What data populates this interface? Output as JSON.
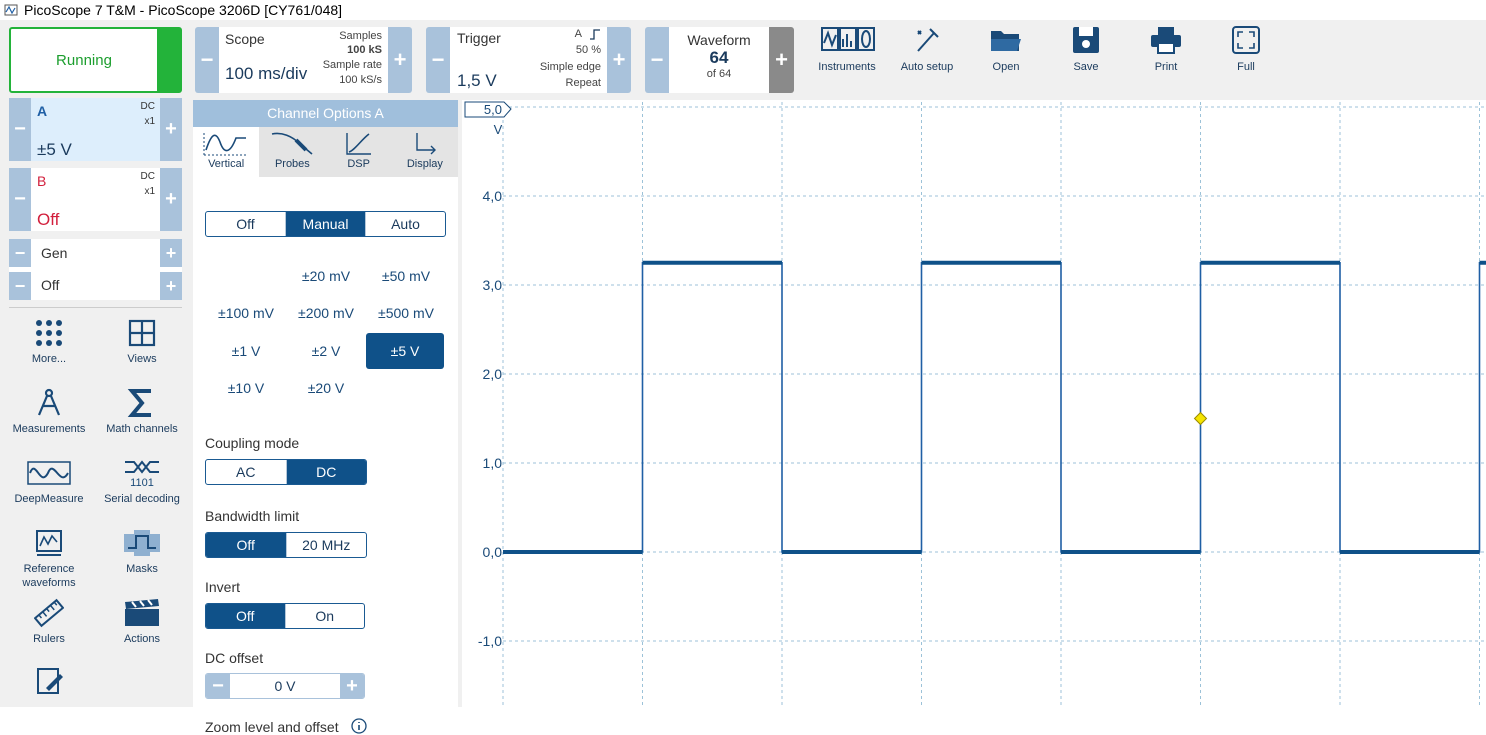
{
  "window": {
    "title": "PicoScope 7 T&M  - PicoScope 3206D [CY761/048]"
  },
  "toolbar": {
    "run": "Running",
    "scope": {
      "label": "Scope",
      "timebase": "100 ms/div",
      "samples_label": "Samples",
      "samples": "100 kS",
      "rate_label": "Sample rate",
      "rate": "100 kS/s"
    },
    "trigger": {
      "label": "Trigger",
      "level": "1,5 V",
      "channel": "A",
      "percent": "50 %",
      "type": "Simple edge",
      "mode": "Repeat"
    },
    "waveform": {
      "label": "Waveform",
      "current": "64",
      "of": "of 64"
    },
    "buttons": [
      "Instruments",
      "Auto setup",
      "Open",
      "Save",
      "Print",
      "Full"
    ]
  },
  "channels": {
    "a": {
      "name": "A",
      "coupling": "DC",
      "probe": "x1",
      "range": "±5 V",
      "color": "#1f5fa5"
    },
    "b": {
      "name": "B",
      "coupling": "DC",
      "probe": "x1",
      "range": "Off",
      "color": "#d21f3c"
    },
    "gen": {
      "label": "Gen",
      "state": "Off"
    }
  },
  "tools": [
    {
      "label": "More...",
      "icon": "dots-grid-icon"
    },
    {
      "label": "Views",
      "icon": "views-grid-icon"
    },
    {
      "label": "Measurements",
      "icon": "compass-icon"
    },
    {
      "label": "Math channels",
      "icon": "sigma-icon"
    },
    {
      "label": "DeepMeasure",
      "icon": "deepmeasure-icon"
    },
    {
      "label": "Serial decoding",
      "icon": "serial-decoding-icon"
    },
    {
      "label": "Reference waveforms",
      "icon": "reference-waveform-icon"
    },
    {
      "label": "Masks",
      "icon": "mask-icon"
    },
    {
      "label": "Rulers",
      "icon": "ruler-icon"
    },
    {
      "label": "Actions",
      "icon": "clapperboard-icon"
    }
  ],
  "options": {
    "title": "Channel Options",
    "channel": "A",
    "tabs": [
      "Vertical",
      "Probes",
      "DSP",
      "Display"
    ],
    "range_mode": [
      "Off",
      "Manual",
      "Auto"
    ],
    "range_mode_selected": "Manual",
    "ranges": [
      "±20 mV",
      "±50 mV",
      "±100 mV",
      "±200 mV",
      "±500 mV",
      "±1 V",
      "±2 V",
      "±5 V",
      "±10 V",
      "±20 V"
    ],
    "range_selected": "±5 V",
    "coupling_label": "Coupling mode",
    "coupling": [
      "AC",
      "DC"
    ],
    "coupling_selected": "DC",
    "bandwidth_label": "Bandwidth limit",
    "bandwidth": [
      "Off",
      "20 MHz"
    ],
    "bandwidth_selected": "Off",
    "invert_label": "Invert",
    "invert": [
      "Off",
      "On"
    ],
    "invert_selected": "Off",
    "offset_label": "DC offset",
    "offset_value": "0 V",
    "zoom_label": "Zoom level and offset"
  },
  "chart_data": {
    "type": "line",
    "unit": "V",
    "y_ticks": [
      "5,0",
      "4,0",
      "3,0",
      "2,0",
      "1,0",
      "0,0",
      "-1,0"
    ],
    "grid": true,
    "trigger_level": 1.5,
    "series": [
      {
        "x": [
          0,
          1.55,
          1.55,
          3.1,
          3.1,
          4.65,
          4.65,
          6.2,
          6.2,
          7.75,
          7.75,
          9.3,
          9.3,
          10.85,
          10.85,
          11
        ],
        "values": [
          0,
          0,
          3.25,
          3.25,
          0,
          0,
          3.25,
          3.25,
          0,
          0,
          3.25,
          3.25,
          0,
          0,
          3.25,
          3.25
        ]
      }
    ]
  }
}
